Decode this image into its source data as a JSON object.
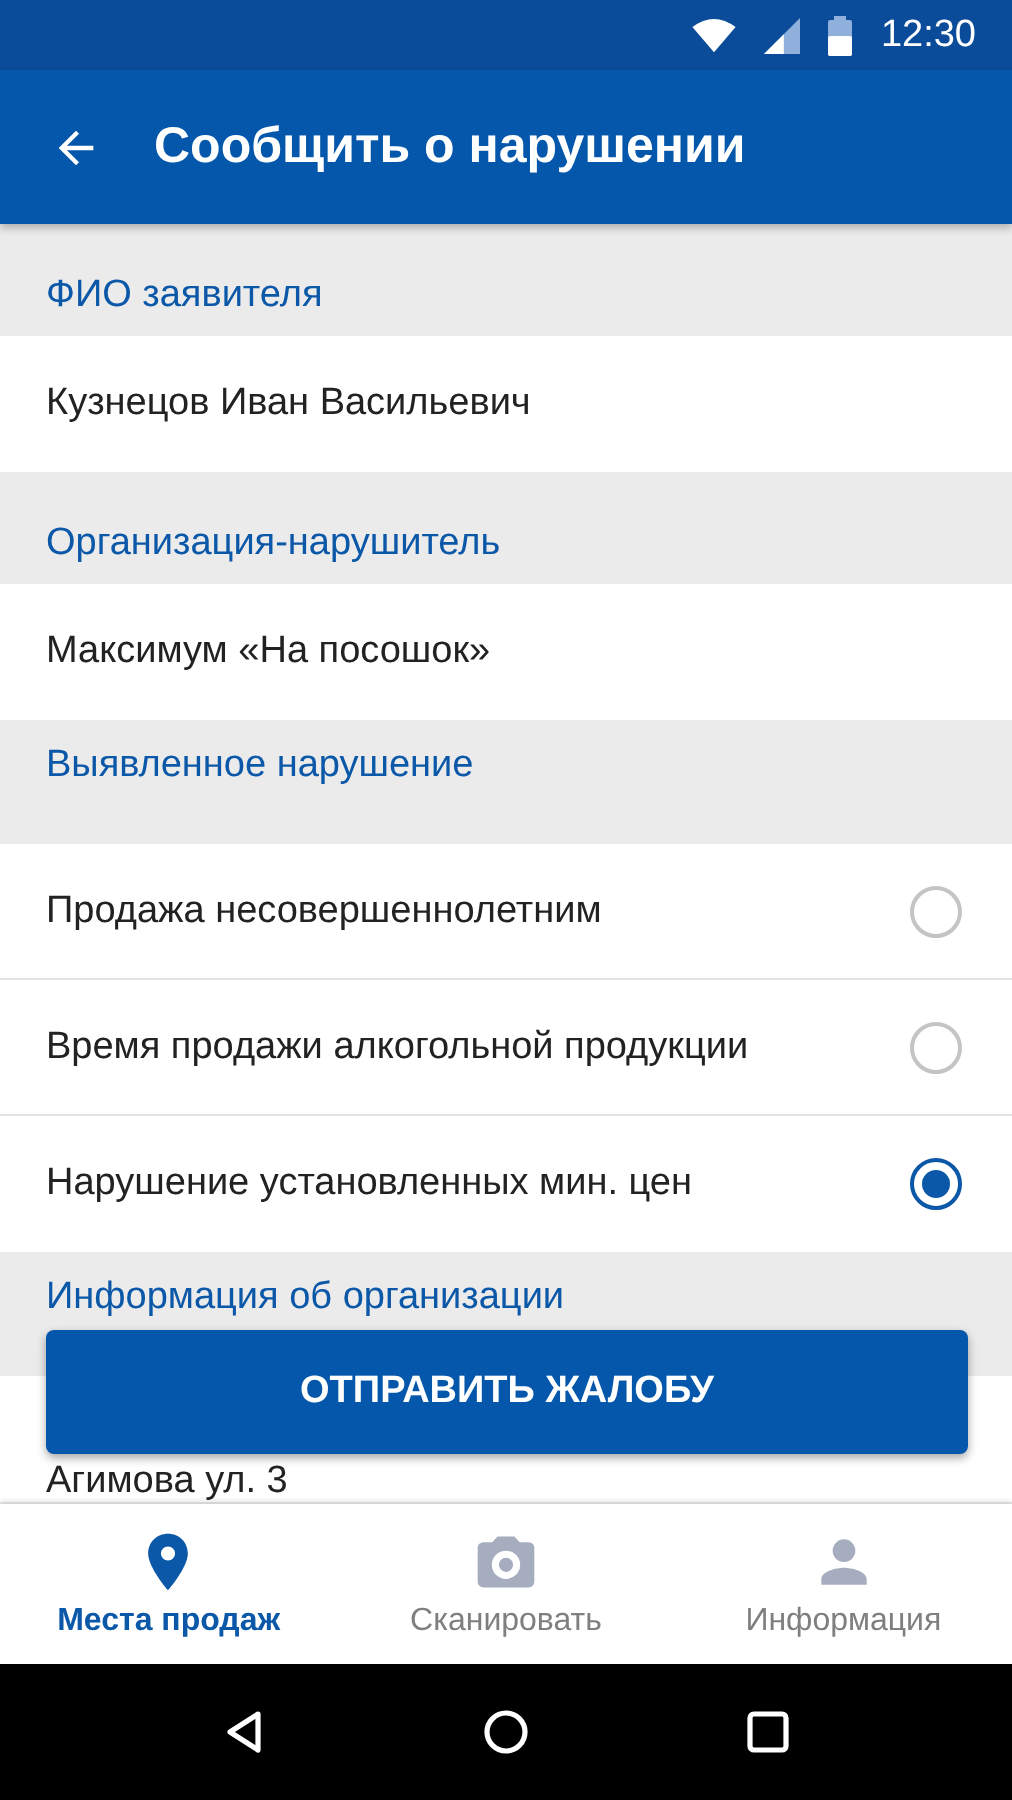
{
  "status_bar": {
    "time": "12:30"
  },
  "app_bar": {
    "title": "Сообщить о нарушении"
  },
  "sections": [
    {
      "heading": "ФИО заявителя",
      "items": [
        {
          "kind": "text",
          "text": "Кузнецов Иван Васильевич"
        }
      ]
    },
    {
      "heading": "Организация-нарушитель",
      "items": [
        {
          "kind": "text",
          "text": "Максимум «На посошок»"
        }
      ]
    },
    {
      "heading": "Выявленное нарушение",
      "items": [
        {
          "kind": "radio",
          "text": "Продажа несовершеннолетним",
          "selected": false
        },
        {
          "kind": "radio",
          "text": "Время продажи алкогольной продукции",
          "selected": false
        },
        {
          "kind": "radio",
          "text": "Нарушение установленных мин. цен",
          "selected": true
        }
      ]
    },
    {
      "heading": "Информация об организации",
      "items": [
        {
          "kind": "text",
          "text": "Агимова ул. 3"
        }
      ]
    }
  ],
  "submit_button": {
    "label": "ОТПРАВИТЬ ЖАЛОБУ"
  },
  "bottom_nav": [
    {
      "label": "Места продаж",
      "selected": true
    },
    {
      "label": "Сканировать",
      "selected": false
    },
    {
      "label": "Информация",
      "selected": false
    }
  ]
}
